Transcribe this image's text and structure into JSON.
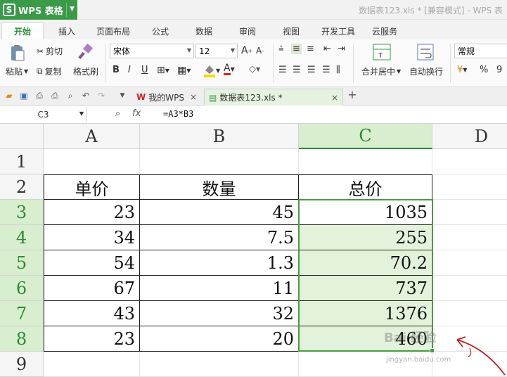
{
  "app": {
    "button_label": "WPS 表格",
    "window_title": "数据表123.xls * [兼容模式] - WPS 表"
  },
  "menu": {
    "tabs": [
      "开始",
      "插入",
      "页面布局",
      "公式",
      "数据",
      "审阅",
      "视图",
      "开发工具",
      "云服务"
    ]
  },
  "ribbon": {
    "paste": "粘贴",
    "cut": "剪切",
    "copy": "复制",
    "format_painter": "格式刷",
    "font_name": "宋体",
    "font_size": "12",
    "merge_center": "合并居中",
    "wrap_text": "自动换行",
    "number_format": "常规",
    "percent": "%",
    "comma": "9"
  },
  "doc_tabs": [
    {
      "label": "我的WPS"
    },
    {
      "label": "数据表123.xls *"
    }
  ],
  "formula_bar": {
    "name_box": "C3",
    "fx": "fx",
    "formula": "=A3*B3"
  },
  "sheet": {
    "columns": [
      "A",
      "B",
      "C",
      "D"
    ],
    "rows": [
      "1",
      "2",
      "3",
      "4",
      "5",
      "6",
      "7",
      "8",
      "9"
    ],
    "headers": [
      "单价",
      "数量",
      "总价"
    ],
    "data": [
      [
        "23",
        "45",
        "1035"
      ],
      [
        "34",
        "7.5",
        "255"
      ],
      [
        "54",
        "1.3",
        "70.2"
      ],
      [
        "67",
        "11",
        "737"
      ],
      [
        "43",
        "32",
        "1376"
      ],
      [
        "23",
        "20",
        "460"
      ]
    ]
  },
  "watermark": {
    "line1": "Bai 经验",
    "line2": "jingyan.baidu.com"
  },
  "colors": {
    "accent": "#3a9a48",
    "selection": "#e3f2da",
    "selection_border": "#4a9a46"
  }
}
